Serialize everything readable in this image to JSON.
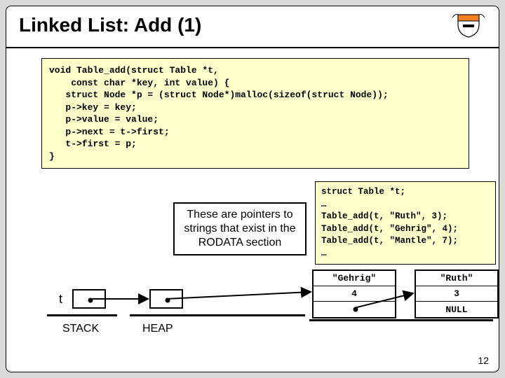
{
  "title": "Linked List: Add (1)",
  "code1": "void Table_add(struct Table *t,\n    const char *key, int value) {\n   struct Node *p = (struct Node*)malloc(sizeof(struct Node));\n   p->key = key;\n   p->value = value;\n   p->next = t->first;\n   t->first = p;\n}",
  "code2": "struct Table *t;\n…\nTable_add(t, \"Ruth\", 3);\nTable_add(t, \"Gehrig\", 4);\nTable_add(t, \"Mantle\", 7);\n…",
  "note": "These are pointers to strings that exist in the RODATA section",
  "t_label": "t",
  "node1": {
    "key": "\"Gehrig\"",
    "val": "4",
    "next_dot": true
  },
  "node2": {
    "key": "\"Ruth\"",
    "val": "3",
    "next": "NULL"
  },
  "sections": {
    "stack": "STACK",
    "heap": "HEAP"
  },
  "page": "12"
}
